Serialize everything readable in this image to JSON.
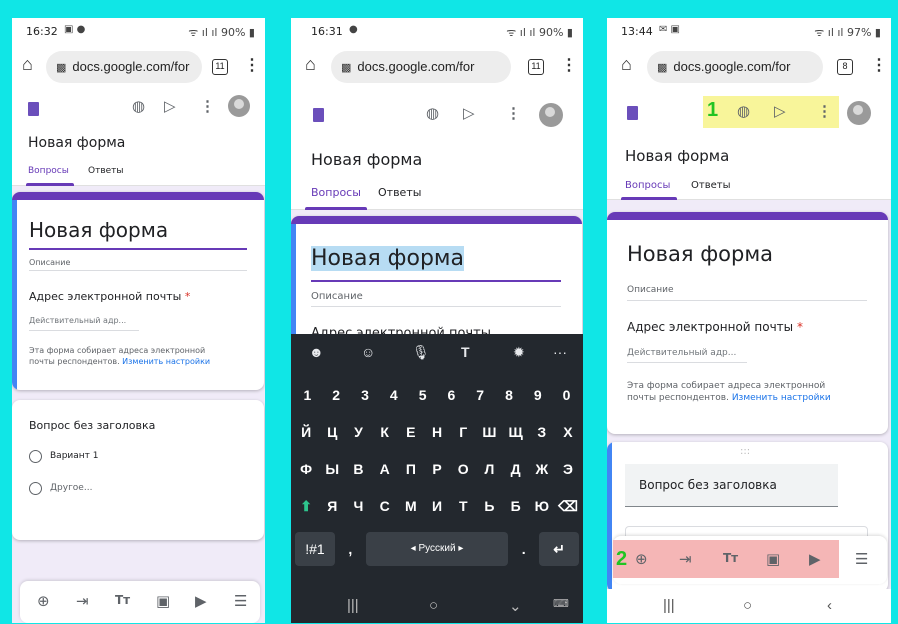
{
  "phone1": {
    "status": {
      "time": "16:32",
      "battery": "90%"
    },
    "browser": {
      "url": "docs.google.com/for",
      "tab_count": "11"
    },
    "form_name": "Новая форма",
    "tabs": [
      "Вопросы",
      "Ответы"
    ],
    "form_title": "Новая форма",
    "description": "Описание",
    "email_label": "Адрес электронной почты",
    "email_required": "*",
    "email_placeholder": "Действительный адр...",
    "note_line1": "Эта форма собирает адреса электронной",
    "note_line2": "почты респондентов.",
    "note_link": "Изменить настройки",
    "question_title": "Вопрос без заголовка",
    "options": [
      "Вариант 1",
      "Другое..."
    ]
  },
  "phone2": {
    "status": {
      "time": "16:31",
      "battery": "90%"
    },
    "browser": {
      "url": "docs.google.com/for",
      "tab_count": "11"
    },
    "form_name": "Новая форма",
    "tabs": [
      "Вопросы",
      "Ответы"
    ],
    "form_title": "Новая форма",
    "description": "Описание",
    "email_label_partial": "Адрес электронной почты",
    "keyboard": {
      "row_numbers": [
        "1",
        "2",
        "3",
        "4",
        "5",
        "6",
        "7",
        "8",
        "9",
        "0"
      ],
      "row1": [
        "Й",
        "Ц",
        "У",
        "К",
        "Е",
        "Н",
        "Г",
        "Ш",
        "Щ",
        "З",
        "Х"
      ],
      "row2": [
        "Ф",
        "Ы",
        "В",
        "А",
        "П",
        "Р",
        "О",
        "Л",
        "Д",
        "Ж",
        "Э"
      ],
      "row3": [
        "Я",
        "Ч",
        "С",
        "М",
        "И",
        "Т",
        "Ь",
        "Б",
        "Ю"
      ],
      "symbols_key": "!#1",
      "comma": ",",
      "space_label": "◂ Русский ▸",
      "period": "."
    }
  },
  "phone3": {
    "status": {
      "time": "13:44",
      "battery": "97%"
    },
    "browser": {
      "url": "docs.google.com/for",
      "tab_count": "8"
    },
    "form_name": "Новая форма",
    "tabs": [
      "Вопросы",
      "Ответы"
    ],
    "form_title": "Новая форма",
    "description": "Описание",
    "email_label": "Адрес электронной почты",
    "email_required": "*",
    "email_placeholder": "Действительный адр...",
    "note_line1": "Эта форма собирает адреса электронной",
    "note_line2": "почты респондентов.",
    "note_link": "Изменить настройки",
    "drag_handle": ":::",
    "question_title": "Вопрос без заголовка",
    "step1": "1",
    "step2": "2"
  },
  "icons": {
    "home": "⌂",
    "lock": "🔒",
    "more": "⋮",
    "palette": "◍",
    "send": "▷",
    "add": "⊕",
    "import": "⇥",
    "text": "Tт",
    "image": "▣",
    "video": "▶",
    "section": "☰",
    "nav_recent": "|||",
    "nav_home": "○",
    "nav_back": "‹"
  },
  "colors": {
    "accent": "#673ab7",
    "link": "#1a73e8",
    "required": "#d93025",
    "background": "#10e6e6"
  }
}
